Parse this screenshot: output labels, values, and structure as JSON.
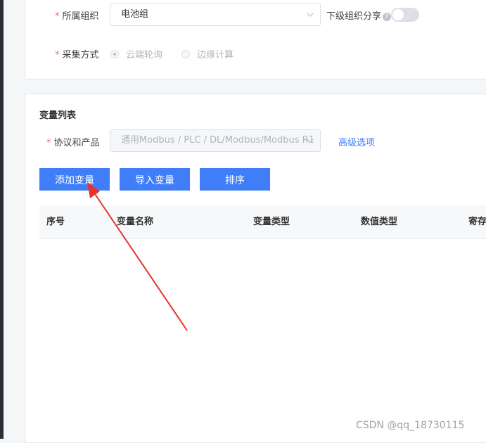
{
  "org": {
    "label": "所属组织",
    "value": "电池组",
    "share_label": "下级组织分享",
    "share_help": "?",
    "share_enabled": false
  },
  "collect": {
    "label": "采集方式",
    "options": [
      {
        "label": "云端轮询",
        "checked": true
      },
      {
        "label": "边缘计算",
        "checked": false
      }
    ]
  },
  "variables": {
    "title": "变量列表",
    "protocol_label": "协议和产品",
    "protocol_value": "通用Modbus / PLC / DL/Modbus/Modbus R1",
    "advanced_link": "高级选项",
    "buttons": {
      "add": "添加变量",
      "import": "导入变量",
      "sort": "排序"
    },
    "columns": [
      "序号",
      "变量名称",
      "变量类型",
      "数值类型",
      "寄存"
    ]
  },
  "required_mark": "*",
  "watermark": "CSDN @qq_18730115",
  "colors": {
    "primary": "#3f7ef8",
    "link": "#3a7cf5",
    "required": "#f56c6c",
    "annotation_arrow": "#e8332a"
  }
}
